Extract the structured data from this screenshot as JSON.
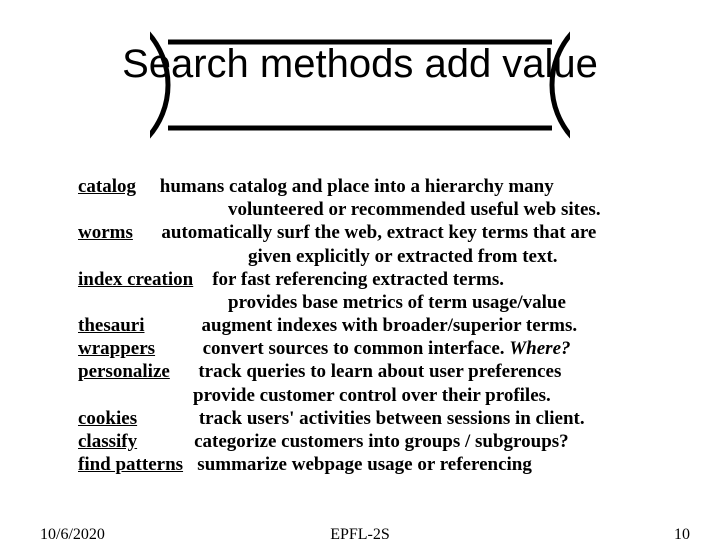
{
  "title": "Search methods add value",
  "terms": {
    "catalog": "catalog",
    "worms": "worms",
    "index_creation": "index creation",
    "thesauri": "thesauri",
    "wrappers": "wrappers",
    "personalize": "personalize",
    "cookies": "cookies",
    "classify": "classify",
    "find_patterns": "find patterns"
  },
  "desc": {
    "catalog_1": "humans catalog and place into a hierarchy many",
    "catalog_2": "volunteered or recommended useful web sites.",
    "worms_1": "automatically surf the web, extract key terms that are",
    "worms_2": "given explicitly or extracted from text.",
    "index_1": "for fast referencing extracted terms.",
    "index_2": "provides base metrics of term usage/value",
    "thesauri": "augment indexes with broader/superior terms.",
    "wrappers": "convert sources to common interface. ",
    "wrappers_where": "Where?",
    "personalize_1": "track queries to learn about user preferences",
    "personalize_2": "provide customer control over their profiles.",
    "cookies": "track users' activities between sessions in client.",
    "classify": "categorize customers into groups / subgroups?",
    "find_patterns": "summarize webpage usage or referencing"
  },
  "footer": {
    "date": "10/6/2020",
    "center": "EPFL-2S",
    "page": "10"
  }
}
